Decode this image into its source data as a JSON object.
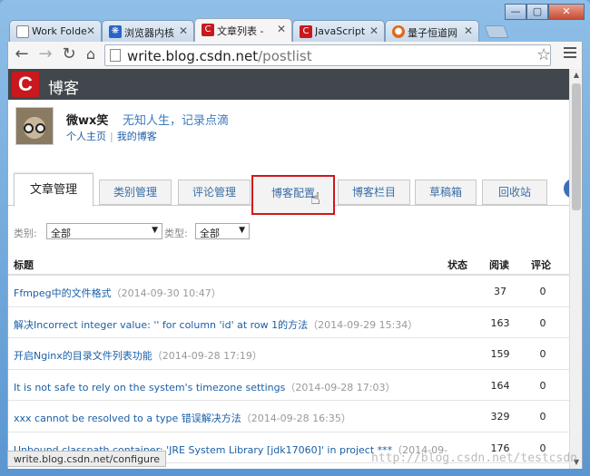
{
  "browser": {
    "tabs": [
      {
        "label": "Work Folde",
        "icon": "page-icon",
        "color": "#888888"
      },
      {
        "label": "浏览器内核",
        "icon": "paw-icon",
        "color": "#2a64c8"
      },
      {
        "label": "文章列表 - ",
        "icon": "csdn-icon",
        "color": "#c9181e",
        "active": true
      },
      {
        "label": "JavaScript",
        "icon": "csdn-icon",
        "color": "#c9181e"
      },
      {
        "label": "量子恒道网",
        "icon": "quantum-icon",
        "color": "#e06a1a"
      }
    ],
    "url_host": "write.blog.csdn.net",
    "url_path": "/postlist",
    "status_url": "write.blog.csdn.net/configure"
  },
  "blog": {
    "logo_letter": "C",
    "header_title": "博客",
    "username": "微wx笑",
    "motto": "无知人生，记录点滴",
    "link_home": "个人主页",
    "link_separator": "|",
    "link_myblog": "我的博客"
  },
  "nav": {
    "tabs": [
      "文章管理",
      "类别管理",
      "评论管理",
      "博客配置",
      "博客栏目",
      "草稿箱",
      "回收站"
    ]
  },
  "filters": {
    "category_label": "类别:",
    "category_value": "全部",
    "type_label": "类型:",
    "type_value": "全部"
  },
  "table": {
    "headers": {
      "title": "标题",
      "status": "状态",
      "reads": "阅读",
      "comments": "评论"
    },
    "rows": [
      {
        "title": "Ffmpeg中的文件格式",
        "date": "（2014-09-30 10:47）",
        "reads": "37",
        "comments": "0"
      },
      {
        "title": "解决Incorrect integer value: '' for column 'id' at row 1的方法",
        "date": "（2014-09-29 15:34）",
        "reads": "163",
        "comments": "0"
      },
      {
        "title": "开启Nginx的目录文件列表功能",
        "date": "（2014-09-28 17:19）",
        "reads": "159",
        "comments": "0"
      },
      {
        "title": "It is not safe to rely on the system's timezone settings",
        "date": "（2014-09-28 17:03）",
        "reads": "164",
        "comments": "0"
      },
      {
        "title": "xxx cannot be resolved to a type 错误解决方法",
        "date": "（2014-09-28 16:35）",
        "reads": "329",
        "comments": "0"
      },
      {
        "title": "Unbound classpath container: 'JRE System Library [jdk17060]' in project ***",
        "date": "（2014-09-",
        "reads": "176",
        "comments": "0"
      }
    ]
  },
  "watermark": "http://blog.csdn.net/testcsdn"
}
